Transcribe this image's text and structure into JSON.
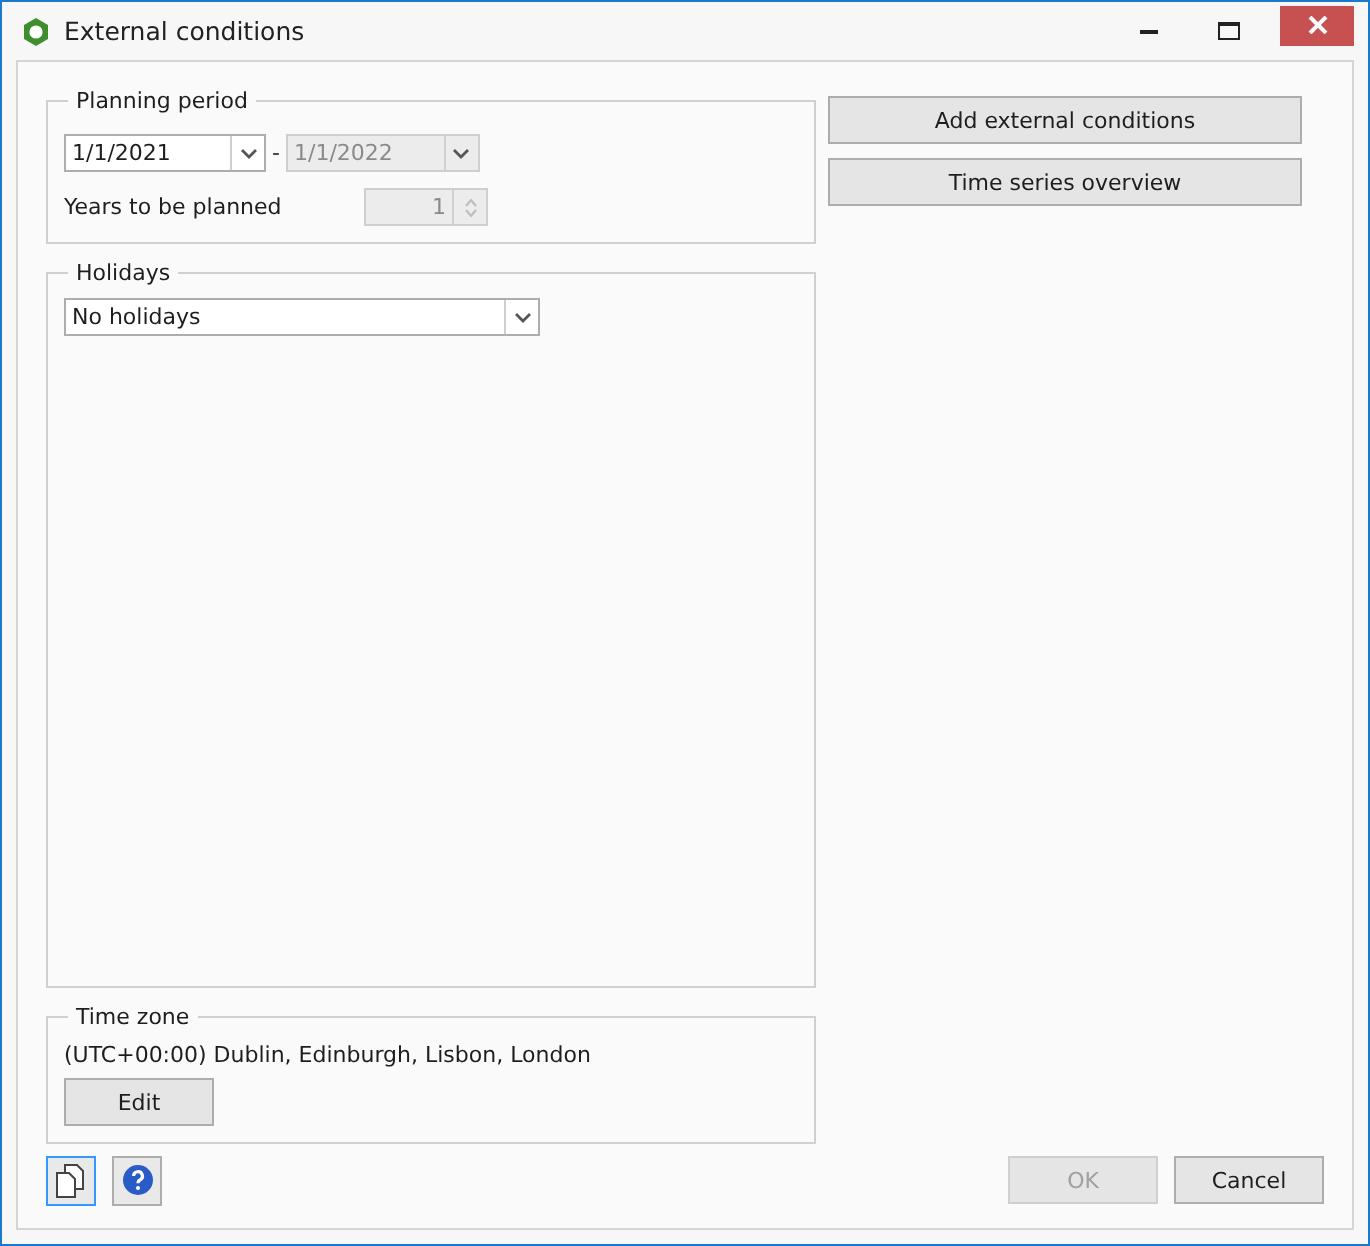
{
  "window": {
    "title": "External conditions"
  },
  "planning_period": {
    "legend": "Planning period",
    "start_date": {
      "value": "1/1/2021",
      "disabled": false
    },
    "separator": "-",
    "end_date": {
      "value": "1/1/2022",
      "disabled": true
    },
    "years_label": "Years to be planned",
    "years": {
      "value": "1",
      "disabled": true
    }
  },
  "holidays": {
    "legend": "Holidays",
    "value": "No holidays"
  },
  "time_zone": {
    "legend": "Time zone",
    "value": "(UTC+00:00) Dublin, Edinburgh, Lisbon, London",
    "button": "Edit"
  },
  "actions": [
    {
      "label": "Add external conditions"
    },
    {
      "label": "Time series overview"
    }
  ],
  "footer_buttons": [
    {
      "label": "OK",
      "disabled": true
    },
    {
      "label": "Cancel",
      "disabled": false
    }
  ]
}
